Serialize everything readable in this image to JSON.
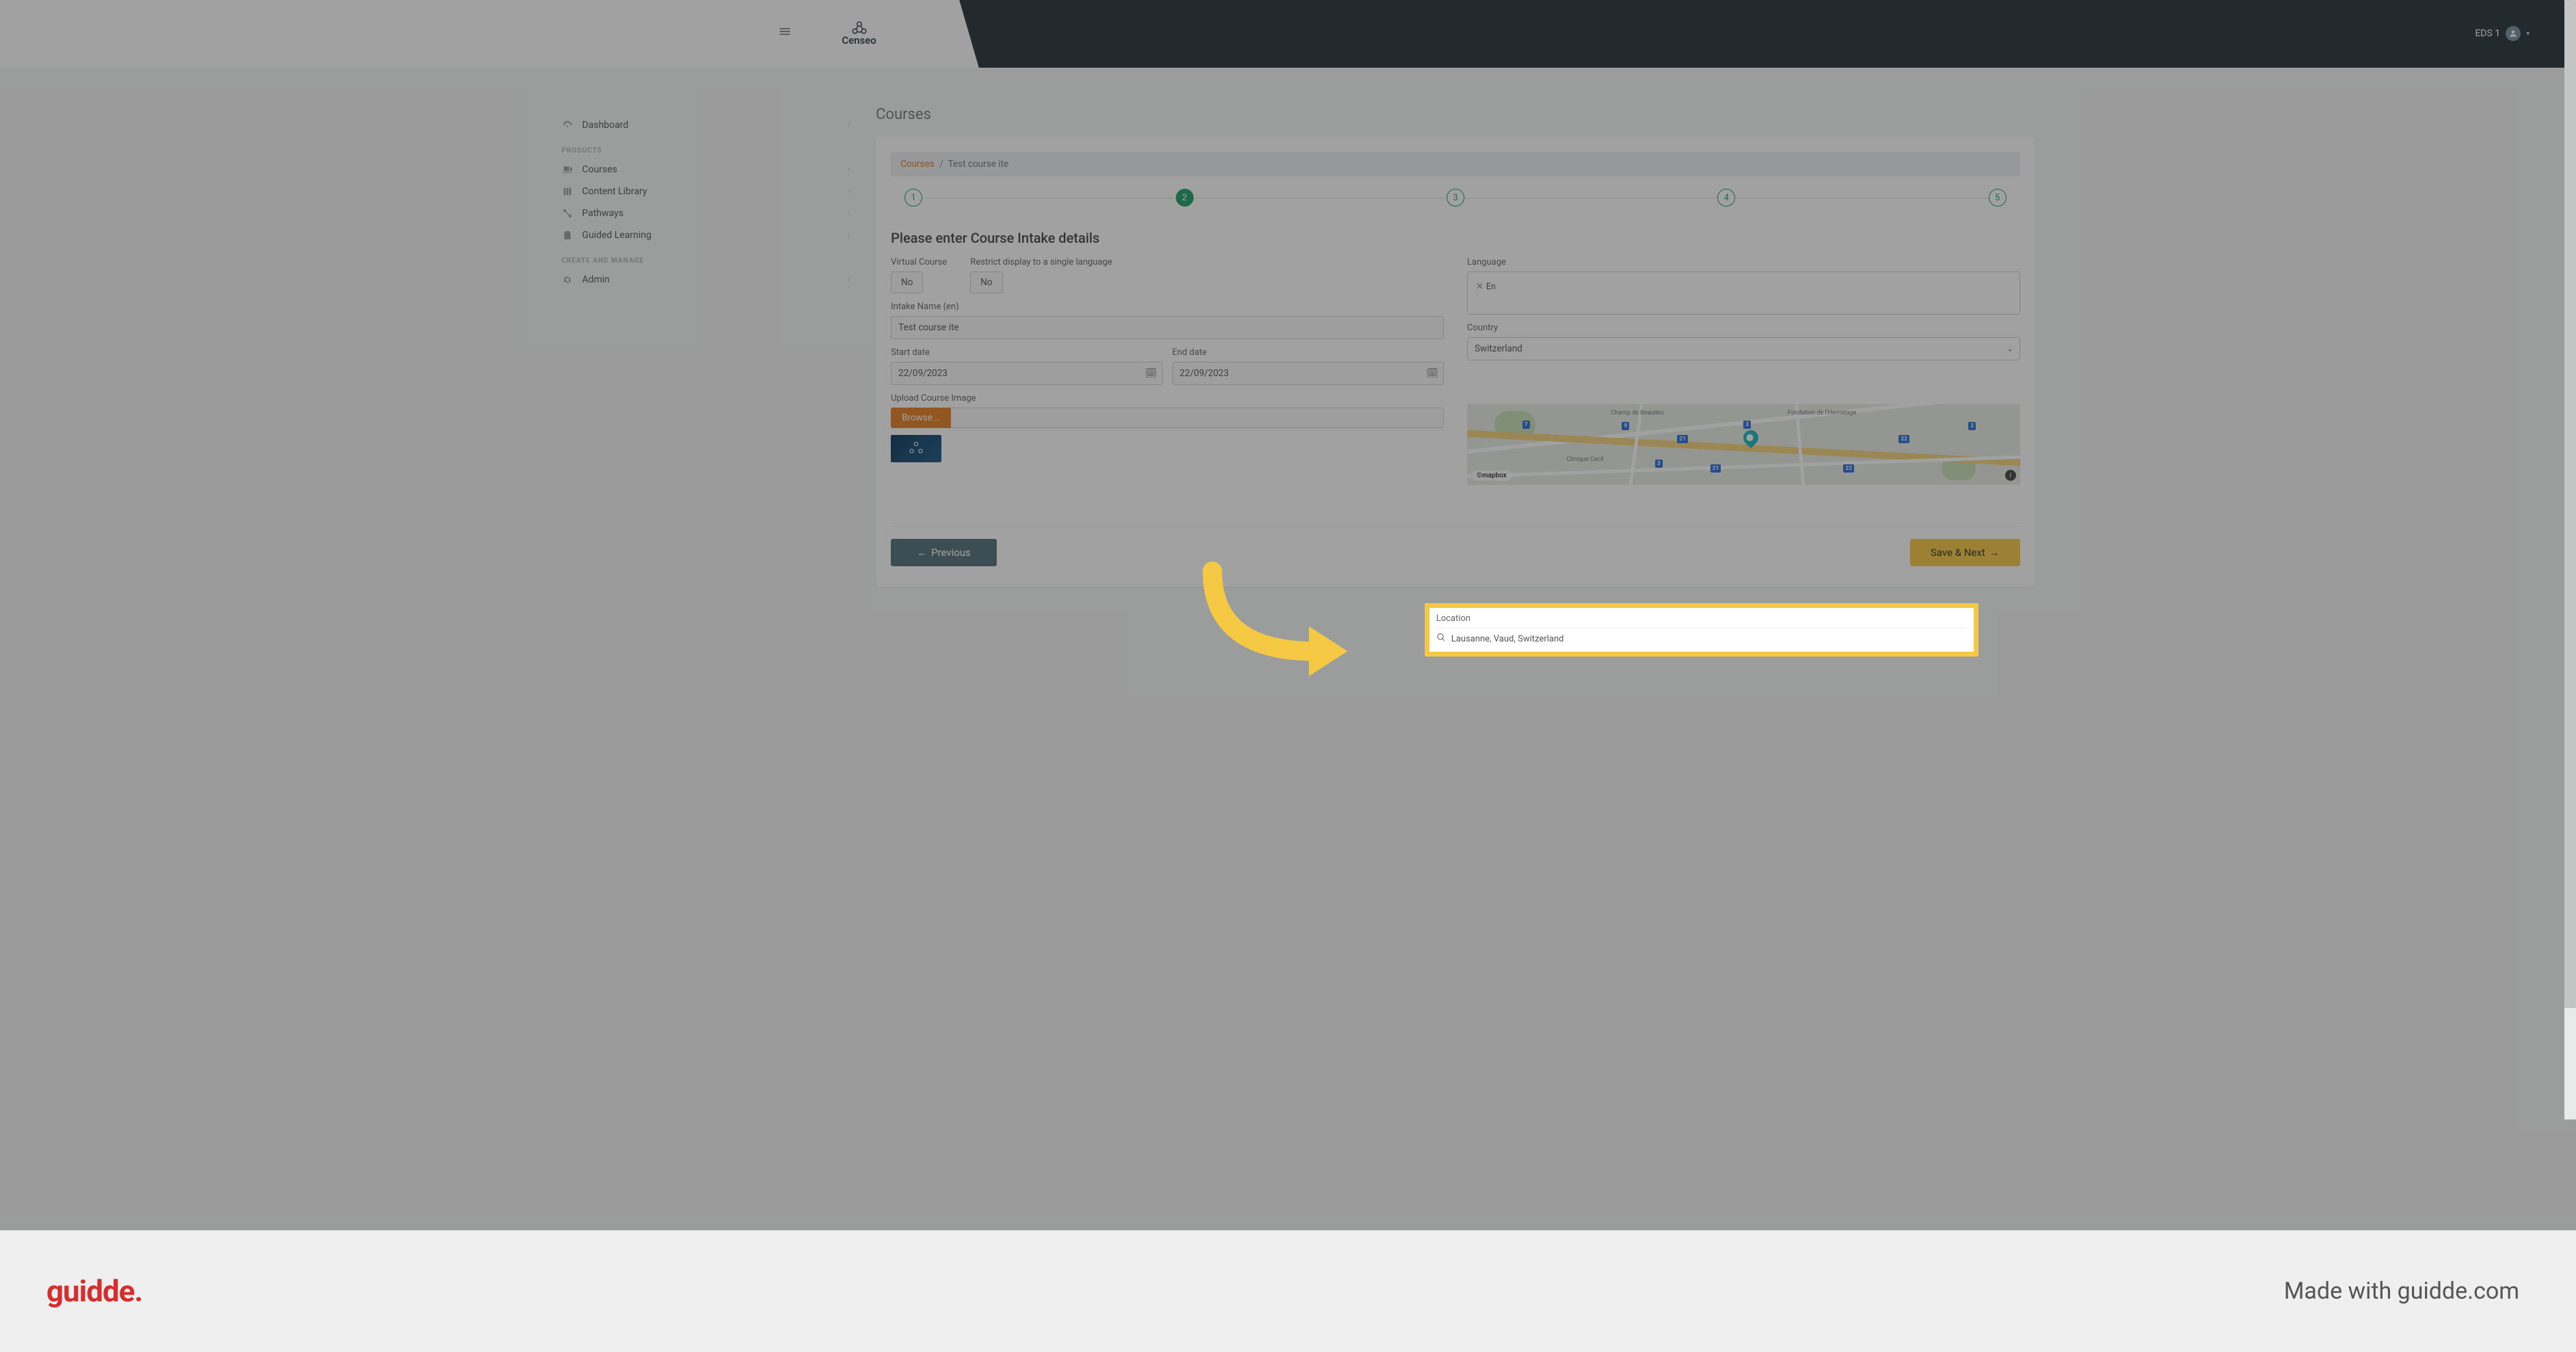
{
  "header": {
    "brand_text": "Censeo",
    "user_label": "EDS 1"
  },
  "sidebar": {
    "items": [
      {
        "label": "Dashboard",
        "icon": "dashboard"
      },
      {
        "label": "Courses",
        "icon": "courses"
      },
      {
        "label": "Content Library",
        "icon": "library"
      },
      {
        "label": "Pathways",
        "icon": "pathways"
      },
      {
        "label": "Guided Learning",
        "icon": "guided"
      },
      {
        "label": "Admin",
        "icon": "admin"
      }
    ],
    "section_products": "PRODUCTS",
    "section_manage": "CREATE AND MANAGE"
  },
  "page": {
    "title": "Courses",
    "breadcrumb": {
      "root": "Courses",
      "current": "Test course ite"
    },
    "stepper": {
      "steps": [
        "1",
        "2",
        "3",
        "4",
        "5"
      ],
      "active_index": 1
    },
    "form_title": "Please enter Course Intake details",
    "labels": {
      "virtual_course": "Virtual Course",
      "restrict_lang": "Restrict display to a single language",
      "language": "Language",
      "intake_name": "Intake Name (en)",
      "country": "Country",
      "start_date": "Start date",
      "end_date": "End date",
      "location": "Location",
      "upload_image": "Upload Course Image"
    },
    "values": {
      "virtual_course": "No",
      "restrict_lang": "No",
      "language_chip": "En",
      "intake_name": "Test course ite",
      "country": "Switzerland",
      "start_date": "22/09/2023",
      "end_date": "22/09/2023",
      "location": "Lausanne, Vaud, Switzerland"
    },
    "map": {
      "attribution": "©mapbox",
      "labels": [
        "Champ de Beauileu",
        "Fondation de l'Hermitage",
        "Clinique Cecil"
      ]
    },
    "buttons": {
      "browse": "Browse...",
      "previous": "Previous",
      "next": "Save & Next"
    }
  },
  "guidde": {
    "logo_text": "guidde.",
    "made_with": "Made with guidde.com"
  }
}
